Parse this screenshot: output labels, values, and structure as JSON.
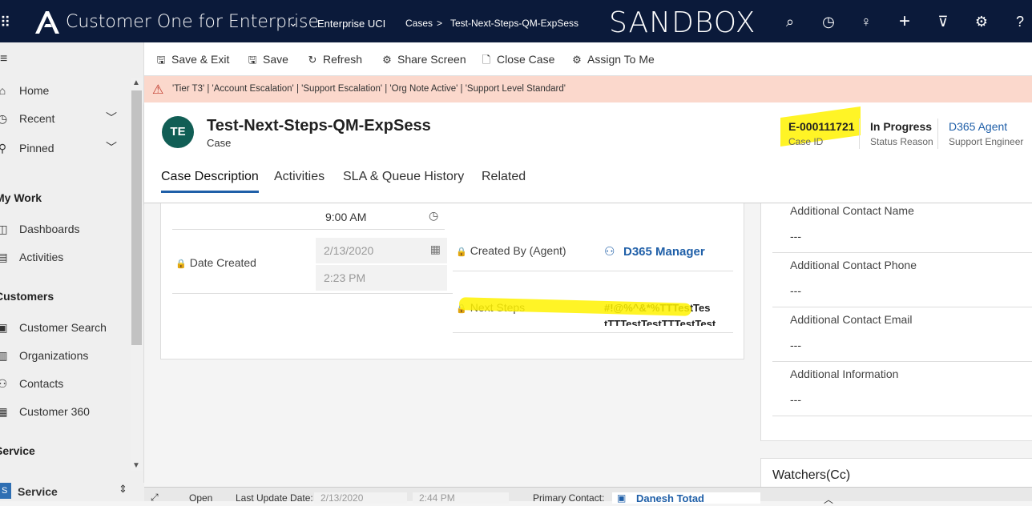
{
  "topbar": {
    "app_name": "Customer One for Enterprise",
    "env_label": "Enterprise UCI",
    "breadcrumb_cases": "Cases",
    "breadcrumb_separator": ">",
    "breadcrumb_record": "Test-Next-Steps-QM-ExpSess",
    "banner": "SANDBOX",
    "icons": [
      "search-icon",
      "task-icon",
      "lightbulb-icon",
      "plus-icon",
      "filter-icon",
      "gear-icon",
      "help-icon"
    ]
  },
  "leftnav": {
    "home": "Home",
    "recent": "Recent",
    "pinned": "Pinned",
    "my_work": "My Work",
    "dashboards": "Dashboards",
    "activities": "Activities",
    "customers": "Customers",
    "customer_search": "Customer Search",
    "organizations": "Organizations",
    "contacts": "Contacts",
    "customer_360": "Customer 360",
    "service_section": "Service",
    "area_badge": "S",
    "area_name": "Service"
  },
  "commands": {
    "save_exit": "Save & Exit",
    "save": "Save",
    "refresh": "Refresh",
    "share_screen": "Share Screen",
    "close_case": "Close Case",
    "assign_to_me": "Assign To Me"
  },
  "alert": {
    "text": "'Tier T3' | 'Account Escalation' | 'Support Escalation' | 'Org Note Active' | 'Support Level Standard'"
  },
  "header": {
    "avatar_initials": "TE",
    "title": "Test-Next-Steps-QM-ExpSess",
    "entity": "Case",
    "case_id_value": "E-000111721",
    "case_id_label": "Case ID",
    "status_value": "In Progress",
    "status_label": "Status Reason",
    "engineer_value": "D365 Agent",
    "engineer_label": "Support Engineer"
  },
  "tabs": [
    "Case Description",
    "Activities",
    "SLA & Queue History",
    "Related"
  ],
  "form": {
    "time_top": "9:00 AM",
    "date_created_label": "Date Created",
    "date_created_date": "2/13/2020",
    "date_created_time": "2:23 PM",
    "created_by_label": "Created By (Agent)",
    "created_by_value": "D365 Manager",
    "next_steps_label": "Next Steps",
    "next_steps_value_line1": "#!@%^&*%TTTestTes",
    "next_steps_value_line2": "tTTTestTestTTTestTest"
  },
  "right_panel": {
    "fields": [
      {
        "label": "Additional Contact Name",
        "value": "---"
      },
      {
        "label": "Additional Contact Phone",
        "value": "---"
      },
      {
        "label": "Additional Contact Email",
        "value": "---"
      },
      {
        "label": "Additional Information",
        "value": "---"
      }
    ],
    "watchers_title": "Watchers(Cc)"
  },
  "footer": {
    "status": "Open",
    "last_update_label": "Last Update Date:",
    "last_update_date": "2/13/2020",
    "last_update_time": "2:44 PM",
    "primary_contact_label": "Primary Contact:",
    "primary_contact_value": "Danesh Totad"
  },
  "colors": {
    "topbar": "#0b1a3a",
    "accent": "#1f5fa8",
    "alert_bg": "#fbd8cc",
    "avatar": "#115e55",
    "highlight": "#fff200"
  }
}
